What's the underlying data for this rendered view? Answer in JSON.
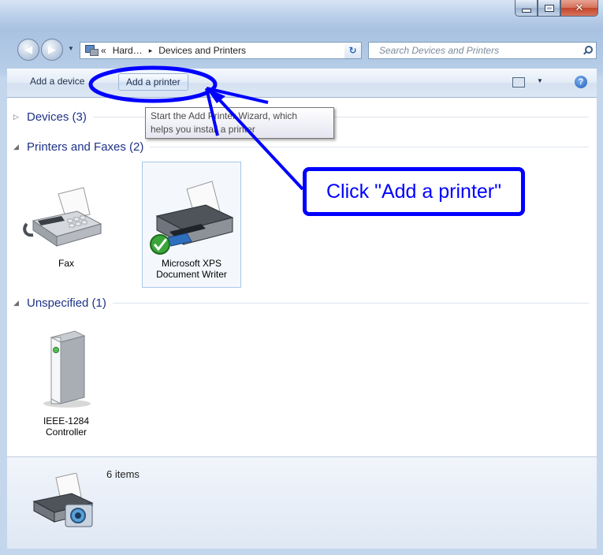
{
  "window": {
    "caption_buttons": {
      "minimize": "minimize-icon",
      "maximize": "maximize-icon",
      "close": "✕"
    }
  },
  "address_bar": {
    "overflow": "«",
    "crumbs": [
      "Hard…",
      "Devices and Printers"
    ],
    "separator": "▸",
    "search_placeholder": "Search Devices and Printers"
  },
  "toolbar": {
    "add_device": "Add a device",
    "add_printer": "Add a printer",
    "help": "?"
  },
  "tooltip": {
    "line1": "Start the Add Printer Wizard, which",
    "line2": "helps you install a printer"
  },
  "groups": {
    "devices": {
      "label": "Devices (3)",
      "state": "collapsed",
      "glyph": "▷"
    },
    "printers": {
      "label": "Printers and Faxes (2)",
      "state": "expanded",
      "glyph": "◢"
    },
    "unspecified": {
      "label": "Unspecified (1)",
      "state": "expanded",
      "glyph": "◢"
    }
  },
  "items": {
    "fax": {
      "label": "Fax"
    },
    "xps": {
      "line1": "Microsoft XPS",
      "line2": "Document Writer",
      "default": true
    },
    "ieee": {
      "line1": "IEEE-1284",
      "line2": "Controller"
    }
  },
  "status": {
    "count_text": "6 items"
  },
  "annotation": {
    "text": "Click \"Add a printer\"",
    "color": "#0000ff"
  },
  "colors": {
    "group_header": "#1e3287",
    "window_frame": "#a9c3e2",
    "close_button": "#c2452a"
  }
}
